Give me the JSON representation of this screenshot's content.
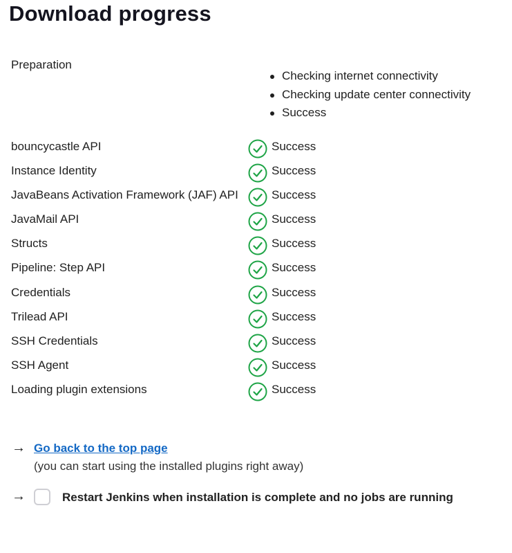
{
  "page": {
    "title": "Download progress"
  },
  "preparation": {
    "label": "Preparation",
    "steps": [
      "Checking internet connectivity",
      "Checking update center connectivity",
      "Success"
    ]
  },
  "plugins": [
    {
      "name": "bouncycastle API",
      "status": "Success"
    },
    {
      "name": "Instance Identity",
      "status": "Success"
    },
    {
      "name": "JavaBeans Activation Framework (JAF) API",
      "status": "Success"
    },
    {
      "name": "JavaMail API",
      "status": "Success"
    },
    {
      "name": "Structs",
      "status": "Success"
    },
    {
      "name": "Pipeline: Step API",
      "status": "Success"
    },
    {
      "name": "Credentials",
      "status": "Success"
    },
    {
      "name": "Trilead API",
      "status": "Success"
    },
    {
      "name": "SSH Credentials",
      "status": "Success"
    },
    {
      "name": "SSH Agent",
      "status": "Success"
    },
    {
      "name": "Loading plugin extensions",
      "status": "Success"
    }
  ],
  "actions": {
    "top_link": "Go back to the top page",
    "top_hint": "(you can start using the installed plugins right away)",
    "restart_label": "Restart Jenkins when installation is complete and no jobs are running",
    "restart_checked": false
  },
  "colors": {
    "success": "#1ea446",
    "link": "#1469c5"
  }
}
